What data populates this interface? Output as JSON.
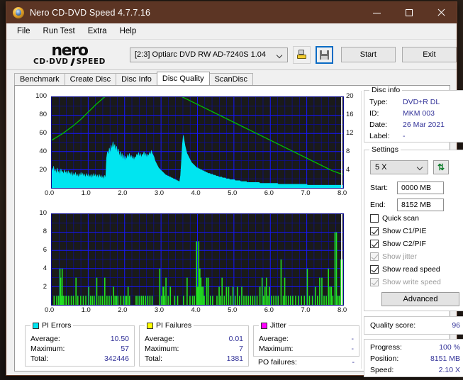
{
  "window": {
    "title": "Nero CD-DVD Speed 4.7.7.16",
    "icon": "nero-disc-icon",
    "minimize_label": "minimize-icon",
    "maximize_label": "maximize-icon",
    "close_label": "close-icon",
    "titlebar_color": "#5c3524"
  },
  "menu": {
    "items": [
      {
        "label": "File"
      },
      {
        "label": "Run Test"
      },
      {
        "label": "Extra"
      },
      {
        "label": "Help"
      }
    ]
  },
  "toolbar": {
    "logo_word": "nero",
    "logo_sub_left": "CD·DVD",
    "logo_sub_right": "SPEED",
    "drive_value": "[2:3]   Optiarc DVD RW AD-7240S 1.04",
    "eject_icon": "eject-disc-icon",
    "save_icon": "floppy-save-icon",
    "start_label": "Start",
    "exit_label": "Exit"
  },
  "tabs": [
    {
      "label": "Benchmark",
      "active": false
    },
    {
      "label": "Create Disc",
      "active": false
    },
    {
      "label": "Disc Info",
      "active": false
    },
    {
      "label": "Disc Quality",
      "active": true
    },
    {
      "label": "ScanDisc",
      "active": false
    }
  ],
  "chart_data": [
    {
      "type": "area",
      "name": "pi-errors-chart",
      "title": "PI Errors",
      "xlabel": "",
      "ylabel": "",
      "x": [
        0.0,
        1.0,
        2.0,
        3.0,
        4.0,
        5.0,
        6.0,
        7.0,
        8.0
      ],
      "xlim": [
        0.0,
        8.0
      ],
      "ylim": [
        0,
        100
      ],
      "ylim_right": [
        0,
        20
      ],
      "yticks": [
        0,
        20,
        40,
        60,
        80,
        100
      ],
      "yticks_right": [
        0,
        4,
        8,
        12,
        16,
        20
      ],
      "xticks": [
        "0.0",
        "1.0",
        "2.0",
        "3.0",
        "4.0",
        "5.0",
        "6.0",
        "7.0",
        "8.0"
      ],
      "grid": true,
      "series": [
        {
          "name": "PI Errors",
          "color": "#00e5f0",
          "kind": "area"
        },
        {
          "name": "Read speed",
          "color": "#00c000",
          "kind": "line"
        }
      ],
      "samples": [
        22,
        18,
        24,
        17,
        20,
        15,
        22,
        16,
        19,
        14,
        21,
        17,
        18,
        15,
        20,
        16,
        18,
        14,
        19,
        15,
        17,
        13,
        18,
        12,
        16,
        13,
        17,
        12,
        15,
        11,
        16,
        12,
        17,
        13,
        16,
        12,
        15,
        11,
        16,
        12,
        15,
        11,
        14,
        10,
        15,
        11,
        16,
        12,
        15,
        11,
        14,
        10,
        15,
        11,
        14,
        10,
        13,
        9,
        14,
        10,
        33,
        40,
        36,
        44,
        38,
        47,
        42,
        51,
        44,
        48,
        40,
        46,
        38,
        43,
        34,
        40,
        32,
        38,
        30,
        36,
        29,
        35,
        31,
        37,
        33,
        38,
        32,
        36,
        31,
        35,
        30,
        34,
        33,
        37,
        35,
        39,
        34,
        38,
        33,
        37,
        36,
        40,
        34,
        38,
        33,
        37,
        35,
        39,
        36,
        41,
        38,
        36,
        34,
        30,
        28,
        26,
        24,
        22,
        21,
        20,
        19,
        18,
        17,
        16,
        15,
        14,
        14,
        13,
        13,
        12,
        12,
        11,
        11,
        10,
        10,
        9,
        9,
        8,
        8,
        7,
        7,
        14,
        30,
        48,
        58,
        52,
        46,
        42,
        38,
        36,
        34,
        32,
        30,
        28,
        27,
        26,
        25,
        24,
        23,
        22,
        22,
        21,
        21,
        20,
        20,
        19,
        19,
        18,
        18,
        17,
        17,
        16,
        16,
        16,
        15,
        15,
        15,
        14,
        14,
        14,
        13,
        13,
        13,
        12,
        12,
        12,
        12,
        11,
        11,
        11,
        11,
        10,
        10,
        10,
        10,
        9,
        9,
        9,
        9,
        9,
        9,
        8,
        8,
        8,
        8,
        8,
        8,
        7,
        7,
        7,
        7,
        7,
        7,
        7,
        6,
        6,
        6,
        6,
        6,
        6,
        6,
        6,
        6,
        6,
        6,
        6,
        6,
        6,
        5,
        5,
        5,
        5,
        5,
        5,
        5,
        5,
        5,
        5,
        5,
        5,
        5,
        5,
        5,
        5,
        5,
        5,
        5,
        5,
        4,
        4,
        4,
        4,
        4,
        4,
        4,
        4,
        4,
        4,
        4,
        4,
        4,
        4,
        4,
        4,
        4,
        4,
        4,
        4,
        4,
        4,
        4,
        4,
        4,
        4,
        4,
        4,
        4,
        4,
        4,
        4,
        3,
        3,
        3,
        3,
        3,
        3,
        3,
        3,
        3,
        3,
        3,
        3,
        3,
        3,
        3,
        3,
        3,
        3,
        3,
        3,
        3,
        3,
        3,
        3,
        3,
        3,
        3,
        3,
        3,
        3,
        3,
        3,
        3,
        3,
        3,
        3,
        3,
        3,
        3,
        3
      ],
      "avg_line": [
        10.5,
        11.0,
        11.5,
        12.0,
        12.6,
        13.2,
        13.8,
        14.5,
        15.2,
        16.0,
        16.8,
        17.6,
        18.4,
        19.1,
        19.8,
        20.5,
        21.2,
        21.8,
        22.4,
        23.0,
        23.4,
        23.6,
        23.5,
        23.2,
        22.8,
        22.4,
        22.1,
        21.8,
        21.6,
        21.4,
        21.3,
        21.2,
        21.0,
        20.8,
        20.5,
        20.2,
        19.8,
        19.4,
        19.0,
        18.6,
        18.2,
        17.8,
        17.4,
        17.0,
        16.6,
        16.2,
        15.8,
        15.4,
        15.0,
        14.6,
        14.2,
        13.8,
        13.4,
        13.0,
        12.6,
        12.2,
        11.8,
        11.4,
        11.0,
        10.6,
        10.2,
        9.8,
        9.4,
        9.0,
        8.6,
        8.2,
        7.8,
        7.4,
        7.0,
        6.6,
        6.2,
        5.8,
        5.4,
        5.0,
        4.6,
        4.2,
        3.8,
        3.5,
        3.2,
        3.0
      ]
    },
    {
      "type": "bar",
      "name": "pi-failures-chart",
      "title": "PI Failures",
      "xlabel": "",
      "ylabel": "",
      "xlim": [
        0.0,
        8.0
      ],
      "ylim": [
        0,
        10
      ],
      "yticks": [
        0,
        2,
        4,
        6,
        8,
        10
      ],
      "xticks": [
        "0.0",
        "1.0",
        "2.0",
        "3.0",
        "4.0",
        "5.0",
        "6.0",
        "7.0",
        "8.0"
      ],
      "grid": true,
      "series": [
        {
          "name": "PI Failures",
          "color": "#22e022",
          "kind": "bar"
        }
      ],
      "bars": [
        [
          0.05,
          1
        ],
        [
          0.12,
          1
        ],
        [
          0.17,
          1
        ],
        [
          0.21,
          4
        ],
        [
          0.23,
          3
        ],
        [
          0.25,
          1
        ],
        [
          0.27,
          4
        ],
        [
          0.3,
          1
        ],
        [
          0.35,
          1
        ],
        [
          0.39,
          1
        ],
        [
          0.45,
          1
        ],
        [
          0.52,
          1
        ],
        [
          0.58,
          1
        ],
        [
          0.65,
          3
        ],
        [
          0.7,
          1
        ],
        [
          0.78,
          1
        ],
        [
          0.85,
          1
        ],
        [
          0.92,
          1
        ],
        [
          1.0,
          2
        ],
        [
          1.05,
          1
        ],
        [
          1.1,
          1
        ],
        [
          1.15,
          1
        ],
        [
          1.22,
          3
        ],
        [
          1.28,
          1
        ],
        [
          1.33,
          1
        ],
        [
          1.38,
          1
        ],
        [
          1.44,
          3
        ],
        [
          1.5,
          1
        ],
        [
          1.56,
          1
        ],
        [
          1.62,
          1
        ],
        [
          1.68,
          2
        ],
        [
          1.72,
          1
        ],
        [
          1.76,
          1
        ],
        [
          1.8,
          1
        ],
        [
          1.88,
          1
        ],
        [
          1.95,
          1
        ],
        [
          2.0,
          1
        ],
        [
          2.04,
          1
        ],
        [
          2.08,
          2
        ],
        [
          2.12,
          1
        ],
        [
          2.3,
          1
        ],
        [
          2.35,
          1
        ],
        [
          2.4,
          1
        ],
        [
          2.45,
          1
        ],
        [
          2.5,
          1
        ],
        [
          2.56,
          1
        ],
        [
          2.62,
          1
        ],
        [
          2.68,
          1
        ],
        [
          2.74,
          1
        ],
        [
          2.95,
          4
        ],
        [
          3.0,
          1
        ],
        [
          3.04,
          2
        ],
        [
          3.06,
          2
        ],
        [
          3.08,
          1
        ],
        [
          3.12,
          3
        ],
        [
          3.18,
          1
        ],
        [
          3.24,
          2
        ],
        [
          3.36,
          1
        ],
        [
          3.44,
          1
        ],
        [
          3.6,
          1
        ],
        [
          3.7,
          3
        ],
        [
          3.78,
          1
        ],
        [
          3.85,
          1
        ],
        [
          3.9,
          1
        ],
        [
          3.96,
          7
        ],
        [
          3.99,
          2
        ],
        [
          4.02,
          7
        ],
        [
          4.05,
          4
        ],
        [
          4.08,
          3
        ],
        [
          4.11,
          2
        ],
        [
          4.14,
          2
        ],
        [
          4.17,
          1
        ],
        [
          4.24,
          3
        ],
        [
          4.28,
          3
        ],
        [
          4.34,
          1
        ],
        [
          4.4,
          1
        ],
        [
          4.52,
          1
        ],
        [
          4.58,
          2
        ],
        [
          4.62,
          1
        ],
        [
          4.66,
          3
        ],
        [
          4.72,
          1
        ],
        [
          4.78,
          2
        ],
        [
          4.84,
          2
        ],
        [
          4.9,
          1
        ],
        [
          4.96,
          2
        ],
        [
          5.02,
          1
        ],
        [
          5.08,
          2
        ],
        [
          5.14,
          1
        ],
        [
          5.2,
          2
        ],
        [
          5.26,
          1
        ],
        [
          5.32,
          1
        ],
        [
          5.38,
          1
        ],
        [
          5.44,
          1
        ],
        [
          5.5,
          1
        ],
        [
          5.56,
          1
        ],
        [
          5.62,
          1
        ],
        [
          5.7,
          2
        ],
        [
          5.76,
          3
        ],
        [
          5.8,
          1
        ],
        [
          5.84,
          2
        ],
        [
          5.88,
          3
        ],
        [
          5.92,
          1
        ],
        [
          5.96,
          2
        ],
        [
          6.02,
          1
        ],
        [
          6.08,
          1
        ],
        [
          6.14,
          1
        ],
        [
          6.2,
          1
        ],
        [
          6.28,
          5
        ],
        [
          6.34,
          1
        ],
        [
          6.38,
          3
        ],
        [
          6.42,
          1
        ],
        [
          6.48,
          1
        ],
        [
          6.54,
          1
        ],
        [
          6.6,
          1
        ],
        [
          6.68,
          1
        ],
        [
          6.76,
          1
        ],
        [
          6.84,
          1
        ],
        [
          6.92,
          1
        ],
        [
          7.0,
          4
        ],
        [
          7.06,
          1
        ],
        [
          7.14,
          1
        ],
        [
          7.22,
          2
        ],
        [
          7.28,
          1
        ],
        [
          7.34,
          3
        ],
        [
          7.4,
          3
        ],
        [
          7.46,
          1
        ],
        [
          7.52,
          1
        ],
        [
          7.58,
          4
        ],
        [
          7.62,
          2
        ],
        [
          7.66,
          2
        ],
        [
          7.7,
          1
        ],
        [
          7.76,
          8
        ],
        [
          7.8,
          8
        ],
        [
          7.84,
          1
        ],
        [
          7.88,
          1
        ],
        [
          7.92,
          5
        ],
        [
          7.95,
          5
        ],
        [
          7.97,
          5
        ]
      ]
    }
  ],
  "stats": {
    "pi_errors": {
      "title": "PI Errors",
      "swatch_color": "#00e5f0",
      "rows": [
        {
          "label": "Average:",
          "value": "10.50"
        },
        {
          "label": "Maximum:",
          "value": "57"
        },
        {
          "label": "Total:",
          "value": "342446"
        }
      ]
    },
    "pi_failures": {
      "title": "PI Failures",
      "swatch_color": "#ffff00",
      "rows": [
        {
          "label": "Average:",
          "value": "0.01"
        },
        {
          "label": "Maximum:",
          "value": "7"
        },
        {
          "label": "Total:",
          "value": "1381"
        }
      ]
    },
    "jitter": {
      "title": "Jitter",
      "swatch_color": "#ff00ff",
      "rows": [
        {
          "label": "Average:",
          "value": "-"
        },
        {
          "label": "Maximum:",
          "value": "-"
        }
      ],
      "po_label": "PO failures:",
      "po_value": "-"
    }
  },
  "disc_info": {
    "title": "Disc info",
    "rows": [
      {
        "label": "Type:",
        "value": "DVD+R DL"
      },
      {
        "label": "ID:",
        "value": "MKM 003"
      },
      {
        "label": "Date:",
        "value": "26 Mar 2021"
      },
      {
        "label": "Label:",
        "value": "-"
      }
    ]
  },
  "settings": {
    "title": "Settings",
    "speed_value": "5 X",
    "refresh_icon": "refresh-icon",
    "start_label": "Start:",
    "start_value": "0000 MB",
    "end_label": "End:",
    "end_value": "8152 MB",
    "checkboxes": [
      {
        "label": "Quick scan",
        "checked": false,
        "disabled": false
      },
      {
        "label": "Show C1/PIE",
        "checked": true,
        "disabled": false
      },
      {
        "label": "Show C2/PIF",
        "checked": true,
        "disabled": false
      },
      {
        "label": "Show jitter",
        "checked": true,
        "disabled": true
      },
      {
        "label": "Show read speed",
        "checked": true,
        "disabled": false
      },
      {
        "label": "Show write speed",
        "checked": true,
        "disabled": true
      }
    ],
    "advanced_label": "Advanced"
  },
  "quality": {
    "label": "Quality score:",
    "value": "96"
  },
  "progress": {
    "rows": [
      {
        "label": "Progress:",
        "value": "100 %"
      },
      {
        "label": "Position:",
        "value": "8151 MB"
      },
      {
        "label": "Speed:",
        "value": "2.10 X"
      }
    ]
  }
}
